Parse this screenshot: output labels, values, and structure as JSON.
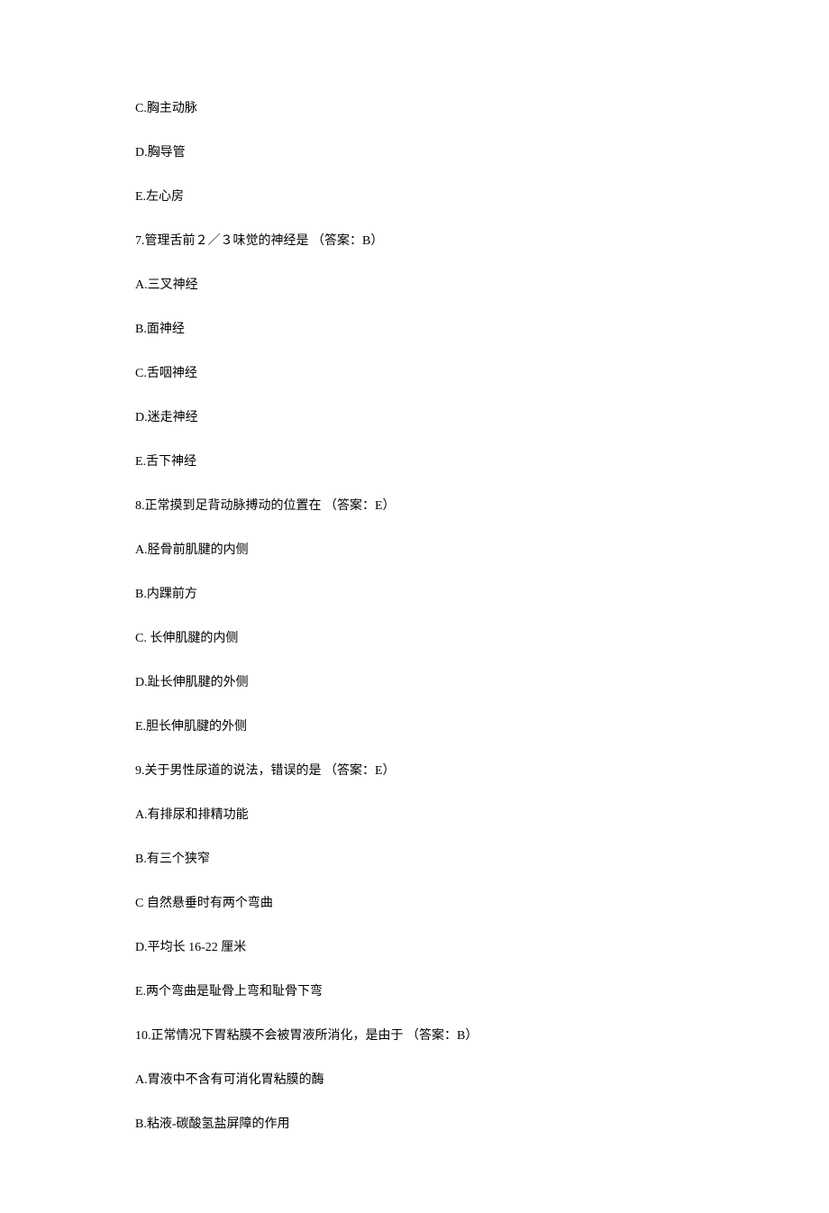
{
  "lines": [
    "C.胸主动脉",
    "D.胸导管",
    "E.左心房",
    "7.管理舌前２／３味觉的神经是 （答案：B）",
    "A.三叉神经",
    "B.面神经",
    "C.舌咽神经",
    "D.迷走神经",
    "E.舌下神经",
    "8.正常摸到足背动脉搏动的位置在 （答案：E）",
    "A.胫骨前肌腱的内侧",
    "B.内踝前方",
    "C. 长伸肌腱的内侧",
    "D.趾长伸肌腱的外侧",
    "E.胆长伸肌腱的外侧",
    "9.关于男性尿道的说法，错误的是 （答案：E）",
    "A.有排尿和排精功能",
    "B.有三个狭窄",
    "C 自然悬垂时有两个弯曲",
    "D.平均长 16-22 厘米",
    "E.两个弯曲是耻骨上弯和耻骨下弯",
    "10.正常情况下胃粘膜不会被胃液所消化，是由于 （答案：B）",
    "A.胃液中不含有可消化胃粘膜的酶",
    "B.粘液-碳酸氢盐屏障的作用"
  ]
}
